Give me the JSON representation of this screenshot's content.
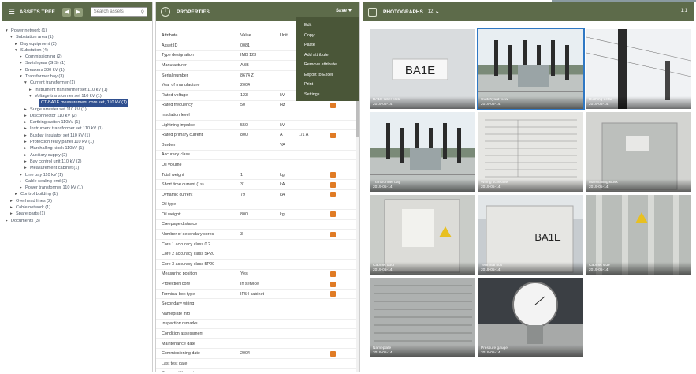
{
  "left_panel": {
    "title": "ASSETS TREE",
    "search_placeholder": "Search assets",
    "tree": [
      {
        "depth": 0,
        "toggle": "▾",
        "label": "Power network (1)"
      },
      {
        "depth": 1,
        "toggle": "▾",
        "label": "Substation area (1)"
      },
      {
        "depth": 2,
        "toggle": "▸",
        "label": "Bay equipment (2)"
      },
      {
        "depth": 2,
        "toggle": "▾",
        "label": "Substation (4)"
      },
      {
        "depth": 3,
        "toggle": "▸",
        "label": "Commissioning (2)"
      },
      {
        "depth": 3,
        "toggle": "▸",
        "label": "Switchgear (GIS) (1)"
      },
      {
        "depth": 3,
        "toggle": "▸",
        "label": "Breakers 380 kV (1)"
      },
      {
        "depth": 3,
        "toggle": "▾",
        "label": "Transformer bay (3)"
      },
      {
        "depth": 4,
        "toggle": "▾",
        "label": "Current transformer (1)"
      },
      {
        "depth": 5,
        "toggle": "▸",
        "label": "Instrument transformer set 110 kV (1)"
      },
      {
        "depth": 5,
        "toggle": "▾",
        "label": "Voltage transformer set 110 kV (1)"
      },
      {
        "depth": 6,
        "toggle": "",
        "label": "CT-BA1E measurement core set, 110 kV (1)",
        "selected": true
      },
      {
        "depth": 4,
        "toggle": "▸",
        "label": "Surge arrester set 110 kV (1)"
      },
      {
        "depth": 4,
        "toggle": "▸",
        "label": "Disconnector 110 kV (2)"
      },
      {
        "depth": 4,
        "toggle": "▸",
        "label": "Earthing switch 110kV (1)"
      },
      {
        "depth": 4,
        "toggle": "▸",
        "label": "Instrument transformer set 110 kV (1)"
      },
      {
        "depth": 4,
        "toggle": "▸",
        "label": "Busbar insulator set 110 kV (1)"
      },
      {
        "depth": 4,
        "toggle": "▸",
        "label": "Protection relay panel 110 kV (1)"
      },
      {
        "depth": 4,
        "toggle": "▸",
        "label": "Marshalling kiosk 110kV (1)"
      },
      {
        "depth": 4,
        "toggle": "▸",
        "label": "Auxiliary supply (2)"
      },
      {
        "depth": 4,
        "toggle": "▸",
        "label": "Bay control unit 110 kV (2)"
      },
      {
        "depth": 4,
        "toggle": "▸",
        "label": "Measurement cabinet (1)"
      },
      {
        "depth": 3,
        "toggle": "▸",
        "label": "Line bay 110 kV (1)"
      },
      {
        "depth": 3,
        "toggle": "▸",
        "label": "Cable sealing end (2)"
      },
      {
        "depth": 3,
        "toggle": "▸",
        "label": "Power transformer 110 kV (1)"
      },
      {
        "depth": 2,
        "toggle": "▸",
        "label": "Control building (1)"
      },
      {
        "depth": 1,
        "toggle": "▸",
        "label": "Overhead lines (2)"
      },
      {
        "depth": 1,
        "toggle": "▸",
        "label": "Cable network (1)"
      },
      {
        "depth": 1,
        "toggle": "▸",
        "label": "Spare parts (1)"
      },
      {
        "depth": 0,
        "toggle": "▸",
        "label": "Documents (3)"
      }
    ]
  },
  "middle_panel": {
    "title": "PROPERTIES",
    "save_label": "Save",
    "columns": [
      "Attribute",
      "Value",
      "Unit"
    ],
    "rows": [
      {
        "name": "Asset ID",
        "value": "0081",
        "unit": "",
        "extra": "",
        "edit": false
      },
      {
        "name": "Type designation",
        "value": "IMB 123",
        "unit": "",
        "extra": "",
        "edit": false
      },
      {
        "name": "Manufacturer",
        "value": "ABB",
        "unit": "",
        "extra": "",
        "edit": false
      },
      {
        "name": "Serial number",
        "value": "8674 Z",
        "unit": "",
        "extra": "",
        "edit": false
      },
      {
        "name": "Year of manufacture",
        "value": "2004",
        "unit": "",
        "extra": "",
        "edit": false
      },
      {
        "name": "Rated voltage",
        "value": "123",
        "unit": "kV",
        "extra": "",
        "edit": false
      },
      {
        "name": "Rated frequency",
        "value": "50",
        "unit": "Hz",
        "extra": "",
        "edit": true
      },
      {
        "name": "Insulation level",
        "value": "",
        "unit": "",
        "extra": "",
        "edit": false
      },
      {
        "name": "Lightning impulse",
        "value": "550",
        "unit": "kV",
        "extra": "",
        "edit": false
      },
      {
        "name": "Rated primary current",
        "value": "800",
        "unit": "A",
        "extra": "1/1 A",
        "edit": true
      },
      {
        "name": "Burden",
        "value": "",
        "unit": "VA",
        "extra": "",
        "edit": false
      },
      {
        "name": "Accuracy class",
        "value": "",
        "unit": "",
        "extra": "",
        "edit": false
      },
      {
        "name": "Oil volume",
        "value": "",
        "unit": "",
        "extra": "",
        "edit": false
      },
      {
        "name": "Total weight",
        "value": "1",
        "unit": "kg",
        "extra": "",
        "edit": true
      },
      {
        "name": "Short time current (1s)",
        "value": "31",
        "unit": "kA",
        "extra": "",
        "edit": true
      },
      {
        "name": "Dynamic current",
        "value": "79",
        "unit": "kA",
        "extra": "",
        "edit": true
      },
      {
        "name": "Oil type",
        "value": "",
        "unit": "",
        "extra": "",
        "edit": false
      },
      {
        "name": "Oil weight",
        "value": "800",
        "unit": "kg",
        "extra": "",
        "edit": true
      },
      {
        "name": "Creepage distance",
        "value": "",
        "unit": "",
        "extra": "",
        "edit": false
      },
      {
        "name": "Number of secondary cores",
        "value": "3",
        "unit": "",
        "extra": "",
        "edit": true
      },
      {
        "name": "Core 1 accuracy class 0.2",
        "value": "",
        "unit": "",
        "extra": "",
        "edit": false
      },
      {
        "name": "Core 2 accuracy class 5P20",
        "value": "",
        "unit": "",
        "extra": "",
        "edit": false
      },
      {
        "name": "Core 3 accuracy class 5P20",
        "value": "",
        "unit": "",
        "extra": "",
        "edit": false
      },
      {
        "name": "Measuring position",
        "value": "Yes",
        "unit": "",
        "extra": "",
        "edit": true
      },
      {
        "name": "Protection core",
        "value": "In service",
        "unit": "",
        "extra": "",
        "edit": true
      },
      {
        "name": "Terminal box type",
        "value": "IP54 cabinet",
        "unit": "",
        "extra": "",
        "edit": true
      },
      {
        "name": "Secondary wiring",
        "value": "",
        "unit": "",
        "extra": "",
        "edit": false
      },
      {
        "name": "Nameplate info",
        "value": "",
        "unit": "",
        "extra": "",
        "edit": false
      },
      {
        "name": "Inspection remarks",
        "value": "",
        "unit": "",
        "extra": "",
        "edit": false
      },
      {
        "name": "Condition assessment",
        "value": "",
        "unit": "",
        "extra": "",
        "edit": false
      },
      {
        "name": "Maintenance date",
        "value": "",
        "unit": "",
        "extra": "",
        "edit": false
      },
      {
        "name": "Commissioning date",
        "value": "2004",
        "unit": "",
        "extra": "",
        "edit": true
      },
      {
        "name": "Last test date",
        "value": "",
        "unit": "",
        "extra": "",
        "edit": false
      },
      {
        "name": "Responsible engineer",
        "value": "",
        "unit": "",
        "extra": "",
        "edit": false
      }
    ],
    "menu": [
      "Edit",
      "Copy",
      "Paste",
      "Add attribute",
      "Remove attribute",
      "Export to Excel",
      "Print",
      "Settings"
    ]
  },
  "right_panel": {
    "title": "PHOTOGRAPHS",
    "count": "12",
    "nav": "▸",
    "scale": "1:1",
    "photos": [
      {
        "kind": "label",
        "caption1": "BA1E label plate",
        "caption2": "2019-05-14",
        "text": "BA1E"
      },
      {
        "kind": "yard",
        "caption1": "Switchyard view",
        "caption2": "2019-05-14",
        "selected": true
      },
      {
        "kind": "insulator",
        "caption1": "Bushing detail",
        "caption2": "2019-05-14"
      },
      {
        "kind": "yard2",
        "caption1": "Transformer bay",
        "caption2": "2019-05-14"
      },
      {
        "kind": "table",
        "caption1": "Wiring schedule",
        "caption2": "2019-05-14"
      },
      {
        "kind": "cabinet",
        "caption1": "Marshalling kiosk",
        "caption2": "2019-05-14"
      },
      {
        "kind": "warning",
        "caption1": "Cabinet door",
        "caption2": "2019-05-14"
      },
      {
        "kind": "box",
        "caption1": "Terminal box",
        "caption2": "2019-05-14",
        "text": "BA1E"
      },
      {
        "kind": "metal",
        "caption1": "Cabinet side",
        "caption2": "2019-05-14"
      },
      {
        "kind": "nameplate",
        "caption1": "Nameplate",
        "caption2": "2019-05-14"
      },
      {
        "kind": "gauge",
        "caption1": "Pressure gauge",
        "caption2": "2019-05-14"
      }
    ]
  }
}
